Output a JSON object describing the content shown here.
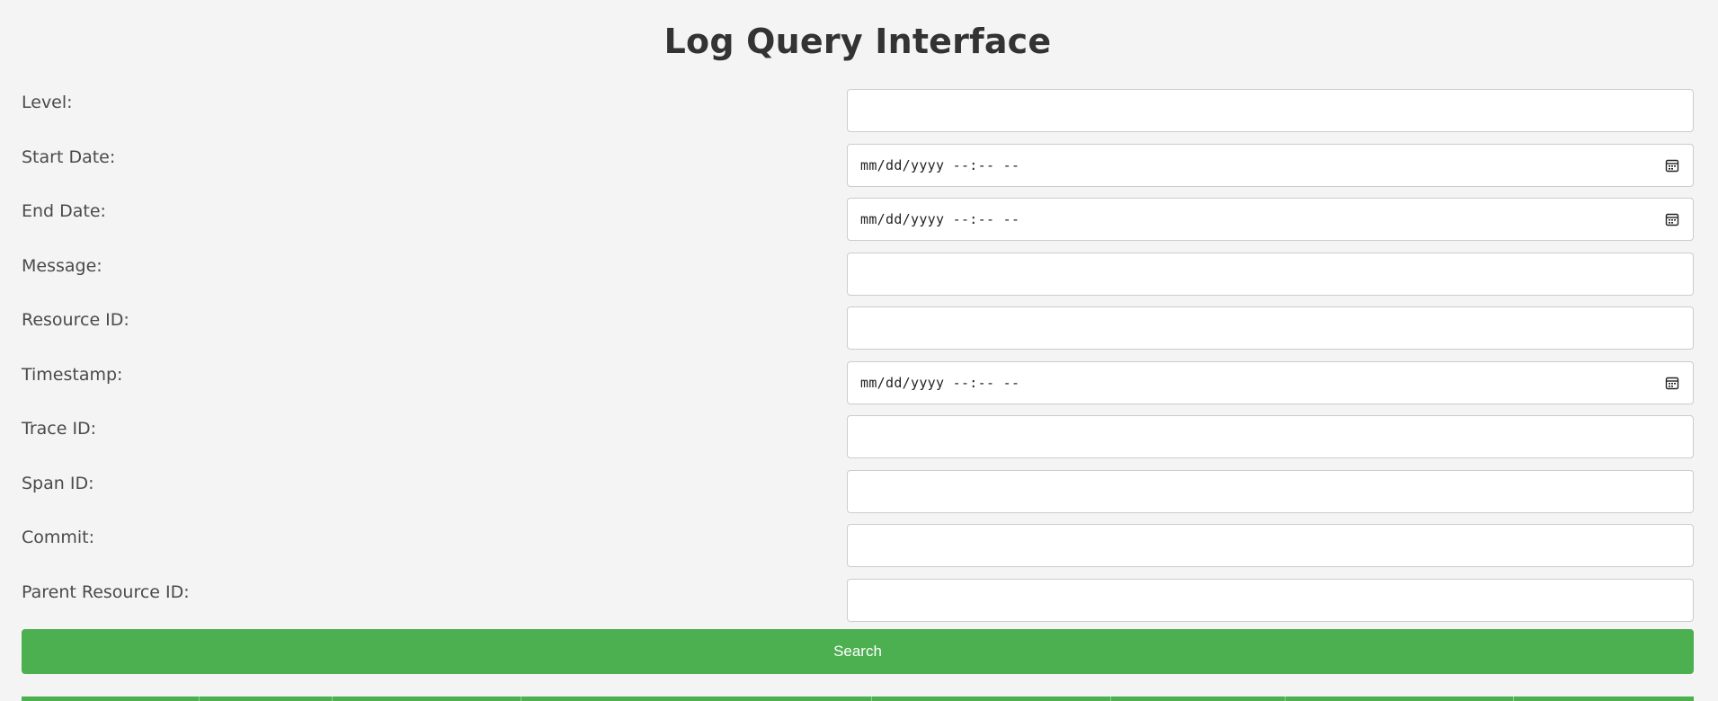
{
  "title": "Log Query Interface",
  "colors": {
    "accent": "#4caf50",
    "background": "#f4f4f4",
    "field_border": "#cccccc"
  },
  "form": {
    "fields": [
      {
        "label": "Level:",
        "type": "text",
        "value": ""
      },
      {
        "label": "Start Date:",
        "type": "datetime",
        "value": "",
        "placeholder": "mm/dd/yyyy --:-- --"
      },
      {
        "label": "End Date:",
        "type": "datetime",
        "value": "",
        "placeholder": "mm/dd/yyyy --:-- --"
      },
      {
        "label": "Message:",
        "type": "text",
        "value": ""
      },
      {
        "label": "Resource ID:",
        "type": "text",
        "value": ""
      },
      {
        "label": "Timestamp:",
        "type": "datetime",
        "value": "",
        "placeholder": "mm/dd/yyyy --:-- --"
      },
      {
        "label": "Trace ID:",
        "type": "text",
        "value": ""
      },
      {
        "label": "Span ID:",
        "type": "text",
        "value": ""
      },
      {
        "label": "Commit:",
        "type": "text",
        "value": ""
      },
      {
        "label": "Parent Resource ID:",
        "type": "text",
        "value": ""
      }
    ],
    "search_label": "Search",
    "calendar_icon": "calendar-icon"
  }
}
